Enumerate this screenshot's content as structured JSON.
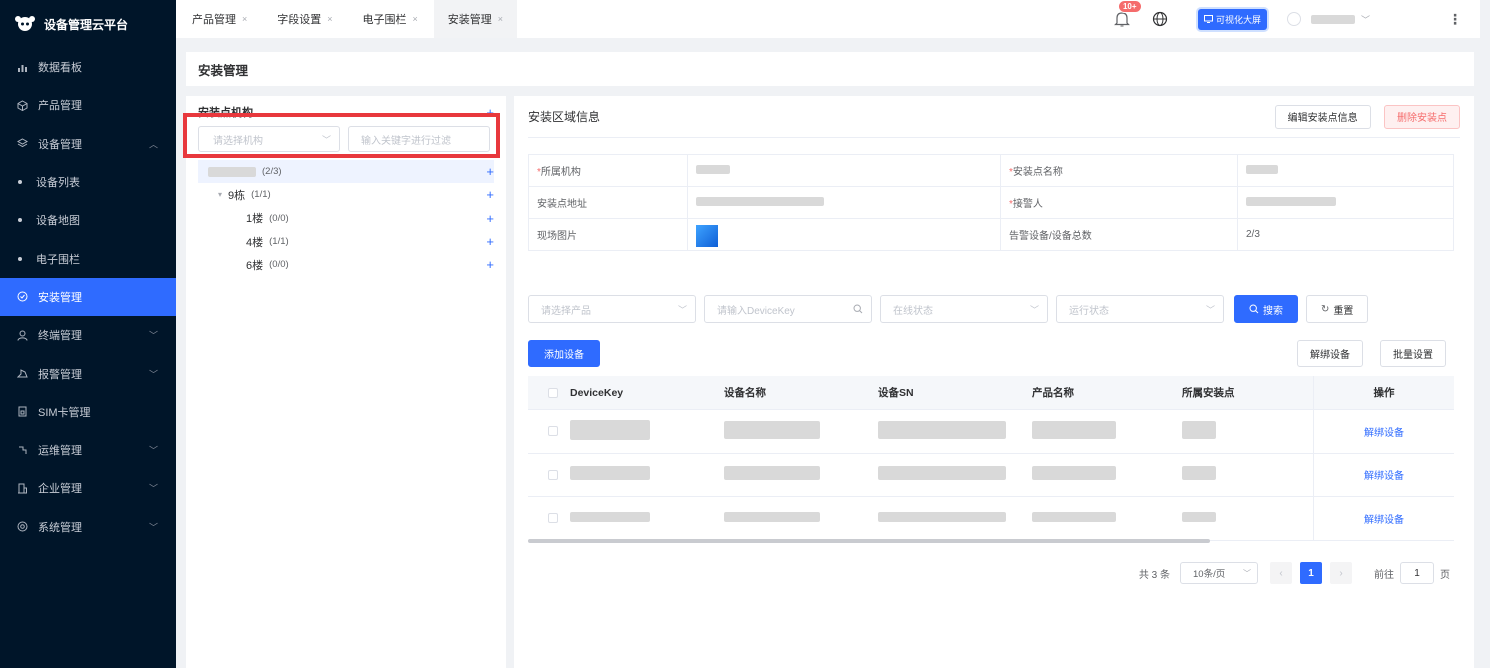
{
  "app": {
    "title": "设备管理云平台"
  },
  "sidebar": {
    "items": [
      {
        "label": "数据看板",
        "icon": "bar-chart-icon"
      },
      {
        "label": "产品管理",
        "icon": "cube-icon"
      },
      {
        "label": "设备管理",
        "icon": "layers-icon",
        "expanded": true
      },
      {
        "label": "设备列表",
        "sub": true
      },
      {
        "label": "设备地图",
        "sub": true
      },
      {
        "label": "电子围栏",
        "sub": true
      },
      {
        "label": "安装管理",
        "icon": "install-icon",
        "active": true
      },
      {
        "label": "终端管理",
        "icon": "user-icon"
      },
      {
        "label": "报警管理",
        "icon": "alarm-icon"
      },
      {
        "label": "SIM卡管理",
        "icon": "sim-icon"
      },
      {
        "label": "运维管理",
        "icon": "wrench-icon"
      },
      {
        "label": "企业管理",
        "icon": "building-icon"
      },
      {
        "label": "系统管理",
        "icon": "gear-icon"
      }
    ]
  },
  "tabs": [
    {
      "label": "产品管理"
    },
    {
      "label": "字段设置"
    },
    {
      "label": "电子围栏"
    },
    {
      "label": "安装管理",
      "active": true
    }
  ],
  "header": {
    "notification_count": "10+",
    "visual_screen_label": "可视化大屏"
  },
  "page": {
    "title": "安装管理"
  },
  "left_panel": {
    "title": "安装点机构",
    "org_select_placeholder": "请选择机构",
    "filter_placeholder": "输入关键字进行过滤",
    "tree": [
      {
        "label": "",
        "count": "(2/3)",
        "level": 0
      },
      {
        "label": "9栋",
        "count": "(1/1)",
        "level": 1
      },
      {
        "label": "1楼",
        "count": "(0/0)",
        "level": 2
      },
      {
        "label": "4楼",
        "count": "(1/1)",
        "level": 2
      },
      {
        "label": "6楼",
        "count": "(0/0)",
        "level": 2
      }
    ]
  },
  "area_info": {
    "title": "安装区域信息",
    "edit_button": "编辑安装点信息",
    "delete_button": "删除安装点",
    "labels": {
      "org": "所属机构",
      "point_name": "安装点名称",
      "address": "安装点地址",
      "contact": "接警人",
      "photo": "现场图片",
      "alarm_total": "告警设备/设备总数"
    },
    "alarm_total_value": "2/3"
  },
  "search": {
    "product_placeholder": "请选择产品",
    "devicekey_placeholder": "请输入DeviceKey",
    "online_placeholder": "在线状态",
    "run_placeholder": "运行状态",
    "search_button": "搜索",
    "reset_button": "重置"
  },
  "actions": {
    "add_device": "添加设备",
    "unbind_device": "解绑设备",
    "batch_set": "批量设置"
  },
  "table": {
    "headers": [
      "DeviceKey",
      "设备名称",
      "设备SN",
      "产品名称",
      "所属安装点",
      "操作"
    ],
    "rows": [
      {
        "op": "解绑设备"
      },
      {
        "op": "解绑设备"
      },
      {
        "op": "解绑设备"
      }
    ]
  },
  "pagination": {
    "total": "共 3 条",
    "page_size": "10条/页",
    "current_page": "1",
    "goto_prefix": "前往",
    "goto_value": "1",
    "goto_suffix": "页"
  },
  "colors": {
    "primary": "#2f6bff",
    "sidebar": "#001529",
    "danger": "#f56c6c"
  }
}
